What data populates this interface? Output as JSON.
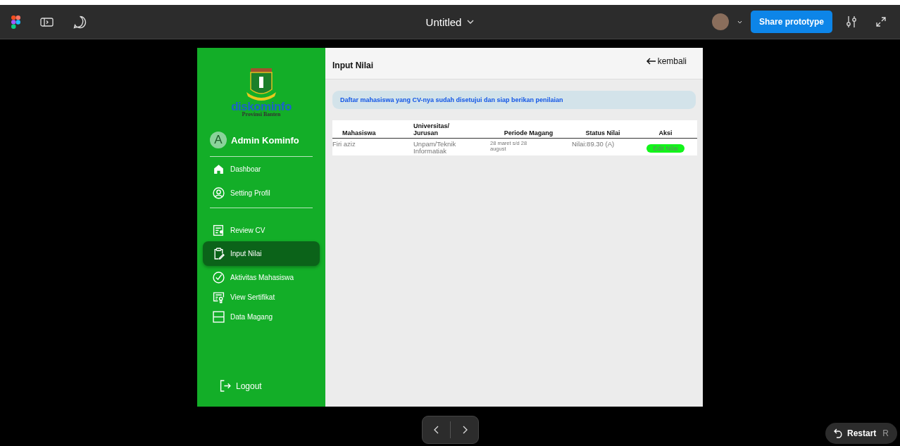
{
  "toolbar": {
    "title": "Untitled",
    "share_button": "Share prototype"
  },
  "sidebar": {
    "logo": {
      "wordmark": "diskominfo",
      "subtitle": "Provinsi Banten"
    },
    "user": {
      "initial": "A",
      "name": "Admin Kominfo"
    },
    "groups": [
      [
        {
          "label": "Dashboar",
          "selected": false
        },
        {
          "label": "Setting Profil",
          "selected": false
        }
      ],
      [
        {
          "label": "Review CV",
          "selected": false
        },
        {
          "label": "Input Nilai",
          "selected": true
        },
        {
          "label": "Aktivitas Mahasiswa",
          "selected": false
        },
        {
          "label": "View Sertifikat",
          "selected": false
        },
        {
          "label": "Data Magang",
          "selected": false
        }
      ]
    ],
    "logout": "Logout"
  },
  "header": {
    "title": "Input Nilai",
    "back_link": "kembali"
  },
  "notice": "Daftar mahasiswa yang CV-nya sudah disetujui dan siap berikan penilaian",
  "table": {
    "columns": [
      "Mahasiswa",
      "Universitas/ Jurusan",
      "Periode Magang",
      "Status Nilai",
      "Aksi"
    ],
    "rows": [
      {
        "mahasiswa": "Firi aziz",
        "universitas": "Unpam/Teknik Informatiak",
        "periode": "28 maret s/d 28 august",
        "status": "Nilai:89.30 (A)",
        "action": "Edit Nilai"
      }
    ]
  },
  "player": {
    "restart": "Restart",
    "restart_key": "R"
  }
}
